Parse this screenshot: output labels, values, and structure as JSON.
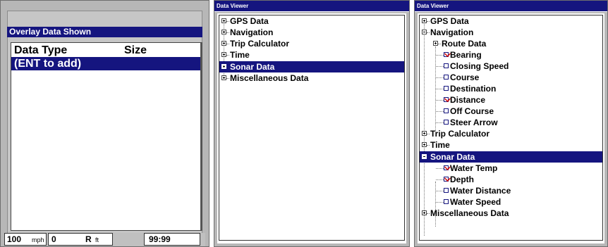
{
  "overlay": {
    "title": "Overlay Data Shown",
    "col_type": "Data Type",
    "col_size": "Size",
    "add_row": "(ENT to add)",
    "status": {
      "speed": "100",
      "speed_unit": "mph",
      "depth": "0",
      "depth_suffix": "R",
      "depth_unit": "ft",
      "time": "99:99"
    }
  },
  "viewer_collapsed": {
    "title": "Data Viewer",
    "items": [
      "GPS Data",
      "Navigation",
      "Trip Calculator",
      "Time",
      "Sonar Data",
      "Miscellaneous Data"
    ]
  },
  "viewer_expanded": {
    "title": "Data Viewer",
    "items": [
      "GPS Data",
      "Navigation",
      "Route Data",
      "Bearing",
      "Closing Speed",
      "Course",
      "Destination",
      "Distance",
      "Off Course",
      "Steer Arrow",
      "Trip Calculator",
      "Time",
      "Sonar Data",
      "Water Temp",
      "Depth",
      "Water Distance",
      "Water Speed",
      "Miscellaneous Data"
    ]
  }
}
